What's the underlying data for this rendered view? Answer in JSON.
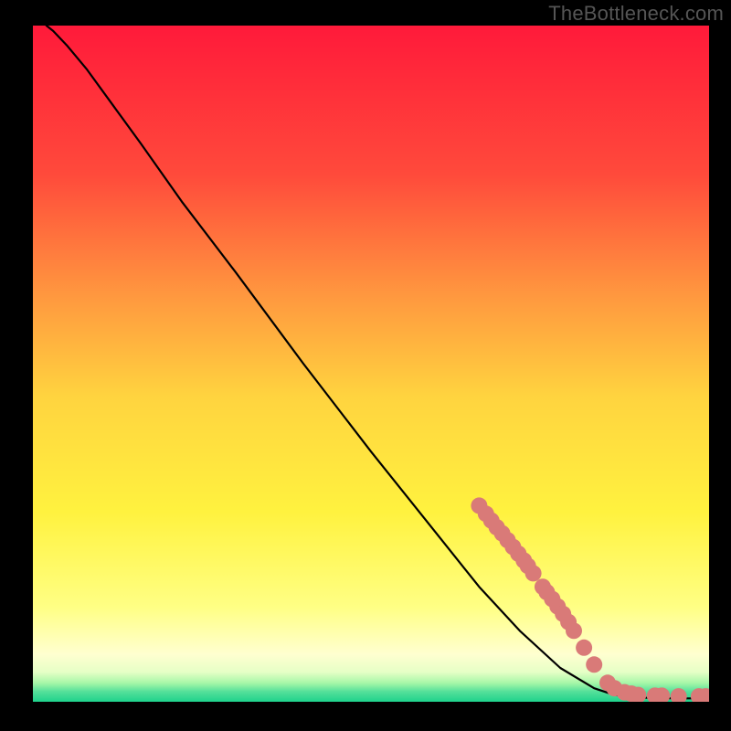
{
  "watermark": "TheBottleneck.com",
  "chart_data": {
    "type": "line",
    "title": "",
    "xlabel": "",
    "ylabel": "",
    "xlim": [
      0,
      100
    ],
    "ylim": [
      0,
      100
    ],
    "gradient_stops": [
      {
        "offset": 0.0,
        "color": "#ff1a3a"
      },
      {
        "offset": 0.22,
        "color": "#ff4a3b"
      },
      {
        "offset": 0.4,
        "color": "#ff983f"
      },
      {
        "offset": 0.55,
        "color": "#ffd43f"
      },
      {
        "offset": 0.72,
        "color": "#fff23f"
      },
      {
        "offset": 0.86,
        "color": "#ffff84"
      },
      {
        "offset": 0.93,
        "color": "#ffffd0"
      },
      {
        "offset": 0.956,
        "color": "#e6ffc6"
      },
      {
        "offset": 0.972,
        "color": "#a8f7a8"
      },
      {
        "offset": 0.985,
        "color": "#55e09a"
      },
      {
        "offset": 1.0,
        "color": "#1fd28c"
      }
    ],
    "curve": [
      {
        "x": 2.0,
        "y": 100.0
      },
      {
        "x": 3.0,
        "y": 99.2
      },
      {
        "x": 5.0,
        "y": 97.1
      },
      {
        "x": 8.0,
        "y": 93.5
      },
      {
        "x": 12.0,
        "y": 88.0
      },
      {
        "x": 16.0,
        "y": 82.5
      },
      {
        "x": 22.0,
        "y": 74.0
      },
      {
        "x": 30.0,
        "y": 63.5
      },
      {
        "x": 40.0,
        "y": 50.0
      },
      {
        "x": 50.0,
        "y": 37.0
      },
      {
        "x": 60.0,
        "y": 24.5
      },
      {
        "x": 66.0,
        "y": 17.0
      },
      {
        "x": 72.0,
        "y": 10.5
      },
      {
        "x": 78.0,
        "y": 5.0
      },
      {
        "x": 83.0,
        "y": 2.0
      },
      {
        "x": 86.0,
        "y": 1.0
      },
      {
        "x": 90.0,
        "y": 0.6
      },
      {
        "x": 95.0,
        "y": 0.5
      },
      {
        "x": 100.0,
        "y": 0.5
      }
    ],
    "markers": [
      {
        "x": 66.0,
        "y": 29.0
      },
      {
        "x": 67.0,
        "y": 27.8
      },
      {
        "x": 67.8,
        "y": 26.8
      },
      {
        "x": 68.6,
        "y": 25.8
      },
      {
        "x": 69.4,
        "y": 24.9
      },
      {
        "x": 70.2,
        "y": 23.9
      },
      {
        "x": 71.0,
        "y": 22.9
      },
      {
        "x": 71.8,
        "y": 21.9
      },
      {
        "x": 72.6,
        "y": 20.9
      },
      {
        "x": 73.2,
        "y": 20.1
      },
      {
        "x": 74.0,
        "y": 19.0
      },
      {
        "x": 75.4,
        "y": 17.0
      },
      {
        "x": 76.0,
        "y": 16.2
      },
      {
        "x": 76.8,
        "y": 15.2
      },
      {
        "x": 77.6,
        "y": 14.1
      },
      {
        "x": 78.4,
        "y": 13.0
      },
      {
        "x": 79.2,
        "y": 11.8
      },
      {
        "x": 80.0,
        "y": 10.5
      },
      {
        "x": 81.5,
        "y": 8.0
      },
      {
        "x": 83.0,
        "y": 5.5
      },
      {
        "x": 85.0,
        "y": 2.8
      },
      {
        "x": 86.0,
        "y": 2.0
      },
      {
        "x": 87.5,
        "y": 1.4
      },
      {
        "x": 88.5,
        "y": 1.2
      },
      {
        "x": 89.5,
        "y": 1.0
      },
      {
        "x": 92.0,
        "y": 0.9
      },
      {
        "x": 93.0,
        "y": 0.9
      },
      {
        "x": 95.5,
        "y": 0.8
      },
      {
        "x": 98.5,
        "y": 0.8
      },
      {
        "x": 99.5,
        "y": 0.8
      }
    ],
    "marker_style": {
      "radius_px": 9,
      "color": "#d97a78"
    }
  }
}
